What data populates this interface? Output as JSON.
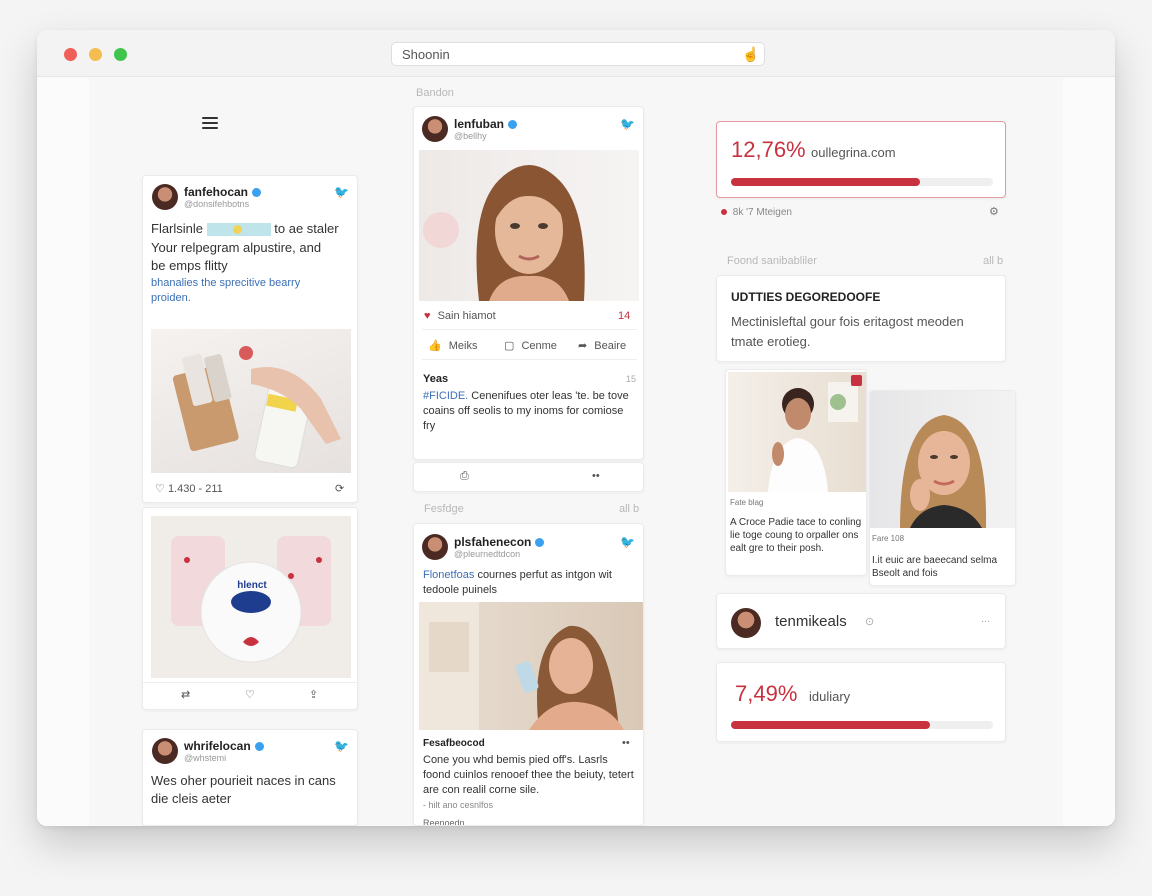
{
  "browser": {
    "url": "Shoonin"
  },
  "col2_label": "Bandon",
  "col2_label2": "Fesfdge",
  "col2_label2_right": "all b",
  "col3_label": "Foond sanibabliler",
  "col3_label_right": "all b",
  "tweet_left_1": {
    "user": "fanfehocan",
    "handle": "@donsifehbotns",
    "text_prefix": "Flarlsinle",
    "text_suffix": "to ae staler",
    "text_line2": "Your relpegram alpustire, and",
    "text_line3": "be emps flitty",
    "link": "bhanalies the sprecitive bearry proiden.",
    "footer_left": "1.430 - 211"
  },
  "tweet_left_2": {
    "product_label": "hlenct"
  },
  "tweet_left_3": {
    "user": "whrifelocan",
    "handle": "@whstemi",
    "text": "Wes oher pourieit naces in cans die cleis aeter"
  },
  "tweet_center_1": {
    "user": "lenfuban",
    "handle": "@bellhy",
    "likes_text": "Sain hiamot",
    "likes_count": "14",
    "like_label": "Meiks",
    "comment_label": "Cenme",
    "share_label": "Beaire",
    "reply_user": "Yeas",
    "reply_time": "15",
    "reply_link": "#FICIDE.",
    "reply_text": "Cenenifues oter leas 'te. be tove coains off seolis to my inoms for comiose fry",
    "sub_more": "••"
  },
  "tweet_center_2": {
    "user": "plsfahenecon",
    "handle": "@pleurnedtdcon",
    "link_part": "Flonetfoas",
    "text": "cournes perfut as intgon wit tedoole puinels",
    "reply_user": "Fesafbeocod",
    "reply_more": "••",
    "reply_text": "Cone you whd bemis pied off's. Lasrls foond cuinlos renooef thee the beiuty, tetert are con realil corne sile.",
    "reply_footer": "- hilt ano cesnlfos",
    "reply_cut": "Reenoedn"
  },
  "stat_card_1": {
    "value": "12,76%",
    "site": "oullegrina.com",
    "fill_fraction": 0.72,
    "sub_text": "8k '7 Mteigen"
  },
  "feature_card": {
    "title": "UDTTIES DEGOREDOOFE",
    "text": "Mectinisleftal gour fois eritagost meoden tmate erotieg."
  },
  "photo_card_1": {
    "caption_label": "Fate blag",
    "caption": "A Croce Padie tace to conling lie toge coung to orpaller ons ealt gre to their posh."
  },
  "photo_card_2": {
    "caption_label": "Fare 108",
    "caption": "I.it euic are baeecand selma Bseolt and fois"
  },
  "profile_row": {
    "name": "tenmikeals",
    "more": "..."
  },
  "stat_card_2": {
    "value": "7,49%",
    "site": "iduliary",
    "fill_fraction": 0.76
  },
  "colors": {
    "accent": "#c8313e",
    "link": "#3b6fb6",
    "verified": "#3aa0f0"
  }
}
